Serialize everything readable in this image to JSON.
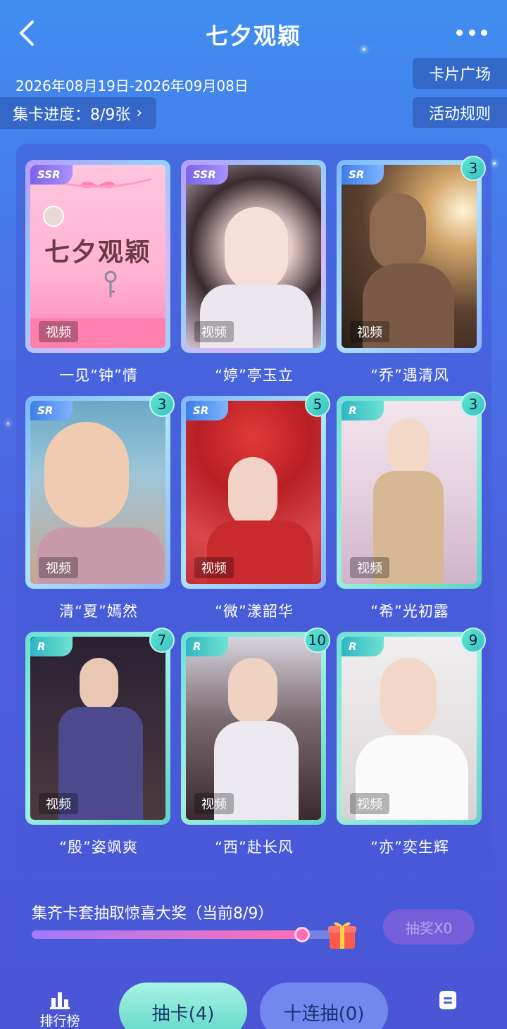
{
  "header": {
    "title": "七夕观颖",
    "date_range": "2026年08月19日-2026年09月08日",
    "progress_label": "集卡进度：8/9张",
    "card_plaza": "卡片广场",
    "event_rules": "活动规则"
  },
  "cards": [
    {
      "name": "一见“钟”情",
      "rarity": "SSR",
      "tag": "视频",
      "count": "",
      "poster_title": "七夕观颖"
    },
    {
      "name": "“婷”亭玉立",
      "rarity": "SSR",
      "tag": "视频",
      "count": ""
    },
    {
      "name": "“乔”遇清风",
      "rarity": "SR",
      "tag": "视频",
      "count": "3"
    },
    {
      "name": "清“夏”嫣然",
      "rarity": "SR",
      "tag": "视频",
      "count": "3"
    },
    {
      "name": "“微”漾韶华",
      "rarity": "SR",
      "tag": "视频",
      "count": "5"
    },
    {
      "name": "“希”光初露",
      "rarity": "R",
      "tag": "视频",
      "count": "3"
    },
    {
      "name": "“殷”姿飒爽",
      "rarity": "R",
      "tag": "视频",
      "count": "7"
    },
    {
      "name": "“西”赴长风",
      "rarity": "R",
      "tag": "视频",
      "count": "10"
    },
    {
      "name": "“亦”奕生辉",
      "rarity": "R",
      "tag": "视频",
      "count": "9"
    }
  ],
  "prize": {
    "text": "集齐卡套抽取惊喜大奖（当前8/9）",
    "progress": 0.889,
    "draw_button": "抽奖X0"
  },
  "bottom_nav": {
    "ranking": "排行榜",
    "draw_card": "抽卡(4)",
    "ten_draw": "十连抽(0)"
  }
}
